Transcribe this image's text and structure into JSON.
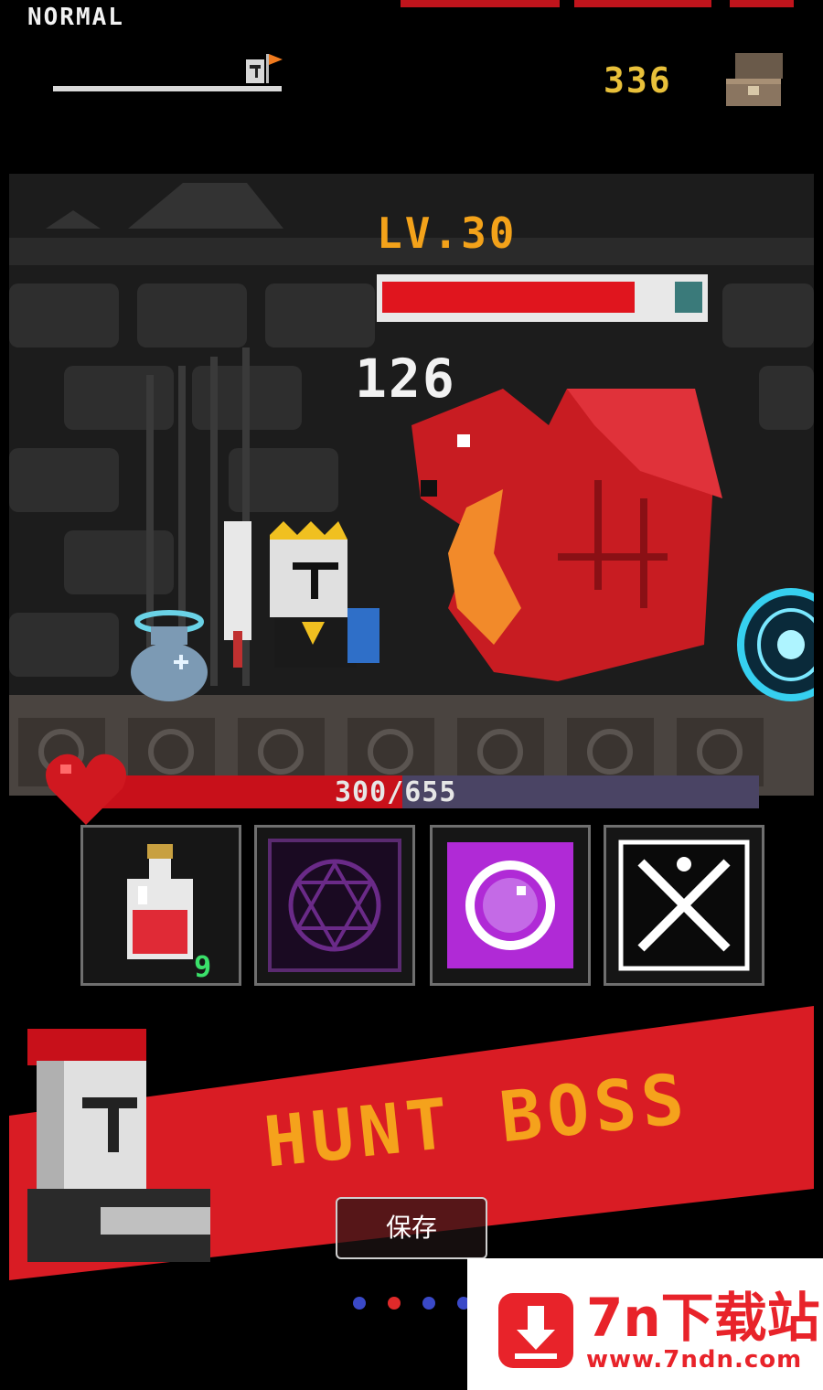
{
  "header": {
    "difficulty": "NORMAL",
    "gold": "336",
    "stage_progress": 0.85
  },
  "battle": {
    "boss_level": "LV.30",
    "boss_hp_fraction": 0.88,
    "damage_number": "126"
  },
  "player": {
    "hp_text": "300/655",
    "hp_current": 300,
    "hp_max": 655
  },
  "skills": [
    {
      "name": "health-potion",
      "count": "9"
    },
    {
      "name": "dark-magic-circle"
    },
    {
      "name": "purple-orb"
    },
    {
      "name": "crossed-swords"
    }
  ],
  "banner": {
    "title": "HUNT BOSS"
  },
  "save_button": {
    "label": "保存"
  },
  "pagination": {
    "dot_colors": [
      "#3a49c8",
      "#e02a2a",
      "#3a49c8",
      "#3a49c8"
    ],
    "active_index": 1
  },
  "watermark": {
    "title": "7n下载站",
    "url": "www.7ndn.com"
  },
  "colors": {
    "boss_hp": "#e0151e",
    "player_hp": "#c8101a",
    "gold": "#e8c03a",
    "level_text": "#f3a21a",
    "banner_red": "#d91c24"
  }
}
